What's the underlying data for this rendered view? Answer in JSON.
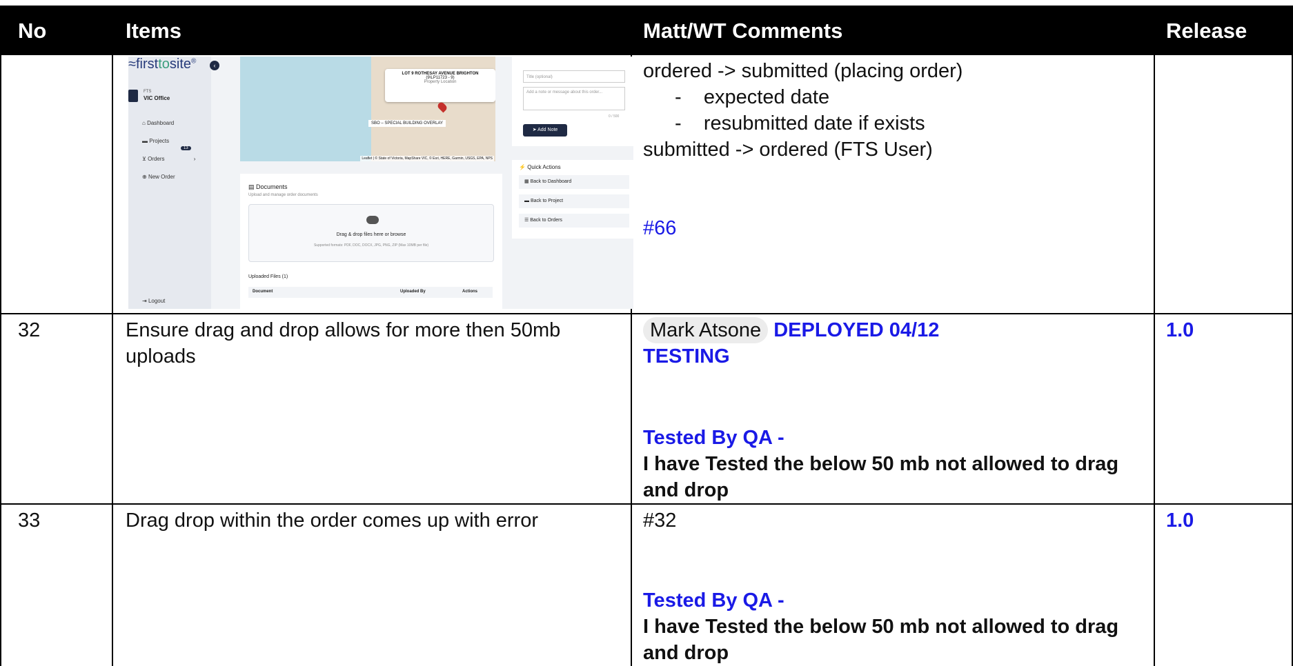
{
  "header": {
    "no": "No",
    "items": "Items",
    "comments": "Matt/WT Comments",
    "release": "Release"
  },
  "row_screenshot": {
    "comment_lines": {
      "l1": "ordered -> submitted (placing order)",
      "l2": "expected date",
      "l3": "resubmitted date if exists",
      "l4": "submitted -> ordered (FTS User)"
    },
    "link": "#66",
    "embedded_app": {
      "logo_first": "first",
      "logo_to": "to",
      "logo_site": "site",
      "logo_mark": "®",
      "office_small": "FTS",
      "office_name": "VIC Office",
      "nav": {
        "dashboard": "Dashboard",
        "projects": "Projects",
        "projects_count": "13",
        "orders": "Orders",
        "new_order": "New Order",
        "logout": "Logout"
      },
      "map": {
        "popup_title": "LOT 9 ROTHESAY AVENUE BRIGHTON",
        "popup_sub": "(9\\LP11723 - 9)",
        "popup_caption": "Property Location",
        "overlay_tag": "SBO – SPECIAL BUILDING OVERLAY",
        "attribution": "Leaflet | © State of Victoria, MapShare VIC, © Esri, HERE, Garmin, USGS, EPA, NPS"
      },
      "notes": {
        "title_placeholder": "Title (optional)",
        "message_placeholder": "Add a note or message about this order...",
        "counter": "0 / 500",
        "add_note": "Add Note"
      },
      "quick_actions": {
        "title": "Quick Actions",
        "back_dashboard": "Back to Dashboard",
        "back_project": "Back to Project",
        "back_orders": "Back to Orders"
      },
      "documents": {
        "title": "Documents",
        "subtitle": "Upload and manage order documents",
        "drop_text": "Drag & drop files here or browse",
        "formats": "Supported formats: PDF, DOC, DOCX, JPG, PNG, ZIP (Max 10MB per file)",
        "uploaded": "Uploaded Files (1)",
        "col_document": "Document",
        "col_uploaded_by": "Uploaded By",
        "col_actions": "Actions"
      }
    }
  },
  "rows": [
    {
      "no": "32",
      "item": "Ensure drag and drop allows for more then 50mb uploads",
      "mention": "Mark Atsone",
      "status": "DEPLOYED 04/12",
      "status2": "TESTING",
      "qa_label": "Tested By QA -",
      "qa_note": "I have Tested the below 50 mb not allowed to drag and drop",
      "release": "1.0"
    },
    {
      "no": "33",
      "item": "Drag drop within the order comes up with error",
      "ref": "#32",
      "qa_label": "Tested By QA -",
      "qa_note": "I have Tested the below 50 mb not allowed to drag and drop",
      "release": "1.0"
    }
  ],
  "colors": {
    "header_bg": "#000000",
    "link_blue": "#1a1ae6"
  }
}
